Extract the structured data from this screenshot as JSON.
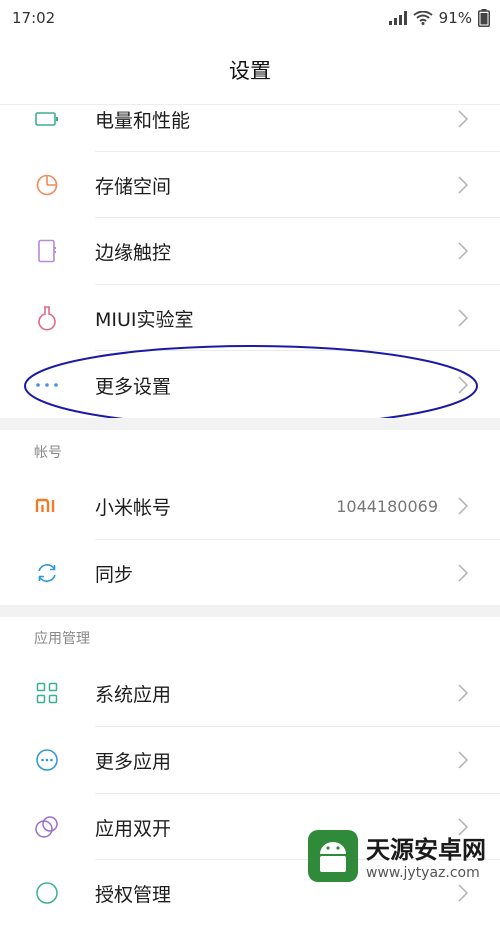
{
  "status_bar": {
    "time": "17:02",
    "battery": "91%"
  },
  "header": {
    "title": "设置"
  },
  "group1": {
    "items": [
      {
        "label": "电量和性能",
        "icon": "battery-icon"
      },
      {
        "label": "存储空间",
        "icon": "storage-pie-icon"
      },
      {
        "label": "边缘触控",
        "icon": "edge-touch-icon"
      },
      {
        "label": "MIUI实验室",
        "icon": "lab-flask-icon"
      },
      {
        "label": "更多设置",
        "icon": "more-dots-icon"
      }
    ]
  },
  "account": {
    "header": "帐号",
    "items": [
      {
        "label": "小米帐号",
        "value": "1044180069",
        "icon": "mi-logo-icon"
      },
      {
        "label": "同步",
        "icon": "sync-icon"
      }
    ]
  },
  "apps": {
    "header": "应用管理",
    "items": [
      {
        "label": "系统应用",
        "icon": "grid-apps-icon"
      },
      {
        "label": "更多应用",
        "icon": "more-apps-icon"
      },
      {
        "label": "应用双开",
        "icon": "dual-apps-icon"
      },
      {
        "label": "授权管理",
        "icon": "permission-icon"
      }
    ]
  },
  "watermark": {
    "brand": "天源安卓网",
    "url": "www.jytyaz.com"
  },
  "colors": {
    "accent_green": "#3bb08f",
    "highlight_blue": "#1a1aa6",
    "mi_orange": "#f07b2a"
  }
}
